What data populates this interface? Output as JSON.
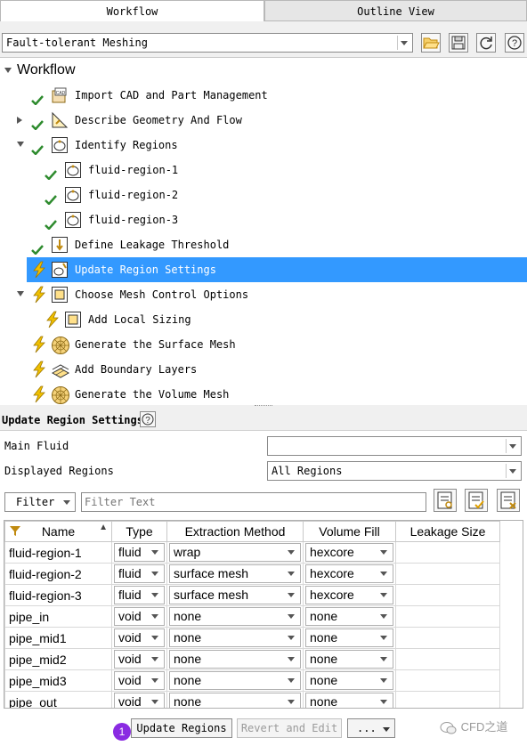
{
  "tabs": [
    {
      "label": "Workflow",
      "active": true
    },
    {
      "label": "Outline View",
      "active": false
    }
  ],
  "workflow_select": {
    "value": "Fault-tolerant Meshing"
  },
  "toolbar_icons": [
    "folder-open-icon",
    "save-icon",
    "refresh-icon",
    "help-icon"
  ],
  "tree": {
    "root_label": "Workflow",
    "items": [
      {
        "label": "Import CAD and Part Management",
        "status": "done",
        "icon": "cad-icon"
      },
      {
        "label": "Describe Geometry And Flow",
        "status": "done",
        "icon": "geometry-icon",
        "expander": "closed"
      },
      {
        "label": "Identify Regions",
        "status": "done",
        "icon": "region-icon",
        "expander": "open"
      },
      {
        "label": "fluid-region-1",
        "status": "done",
        "icon": "region-icon"
      },
      {
        "label": "fluid-region-2",
        "status": "done",
        "icon": "region-icon"
      },
      {
        "label": "fluid-region-3",
        "status": "done",
        "icon": "region-icon"
      },
      {
        "label": "Define Leakage Threshold",
        "status": "done",
        "icon": "threshold-icon"
      },
      {
        "label": "Update Region Settings",
        "status": "pending",
        "icon": "region-settings-icon",
        "selected": true
      },
      {
        "label": "Choose Mesh Control Options",
        "status": "pending",
        "icon": "mesh-control-icon",
        "expander": "open"
      },
      {
        "label": "Add Local Sizing",
        "status": "pending",
        "icon": "mesh-control-icon"
      },
      {
        "label": "Generate the Surface Mesh",
        "status": "pending",
        "icon": "sphere-mesh-icon"
      },
      {
        "label": "Add Boundary Layers",
        "status": "pending",
        "icon": "boundary-layers-icon"
      },
      {
        "label": "Generate the Volume Mesh",
        "status": "pending",
        "icon": "sphere-mesh-icon"
      }
    ]
  },
  "panel": {
    "title": "Update Region Settings",
    "main_fluid_label": "Main Fluid",
    "main_fluid_value": "",
    "displayed_regions_label": "Displayed Regions",
    "displayed_regions_value": "All Regions",
    "filter_button": "Filter",
    "filter_placeholder": "Filter Text"
  },
  "table": {
    "columns": [
      "Name",
      "Type",
      "Extraction Method",
      "Volume Fill",
      "Leakage Size"
    ],
    "rows": [
      [
        "fluid-region-1",
        "fluid",
        "wrap",
        "hexcore",
        ""
      ],
      [
        "fluid-region-2",
        "fluid",
        "surface mesh",
        "hexcore",
        ""
      ],
      [
        "fluid-region-3",
        "fluid",
        "surface mesh",
        "hexcore",
        ""
      ],
      [
        "pipe_in",
        "void",
        "none",
        "none",
        ""
      ],
      [
        "pipe_mid1",
        "void",
        "none",
        "none",
        ""
      ],
      [
        "pipe_mid2",
        "void",
        "none",
        "none",
        ""
      ],
      [
        "pipe_mid3",
        "void",
        "none",
        "none",
        ""
      ],
      [
        "pipe_out",
        "void",
        "none",
        "none",
        ""
      ]
    ]
  },
  "footer": {
    "badge": "1",
    "update_button": "Update Regions",
    "revert_button": "Revert and Edit",
    "more_button": "...",
    "watermark": "CFD之道"
  },
  "colors": {
    "selection": "#3399ff",
    "check": "#2e8b2e",
    "bolt": "#f0c000",
    "badge": "#8a2be2"
  }
}
